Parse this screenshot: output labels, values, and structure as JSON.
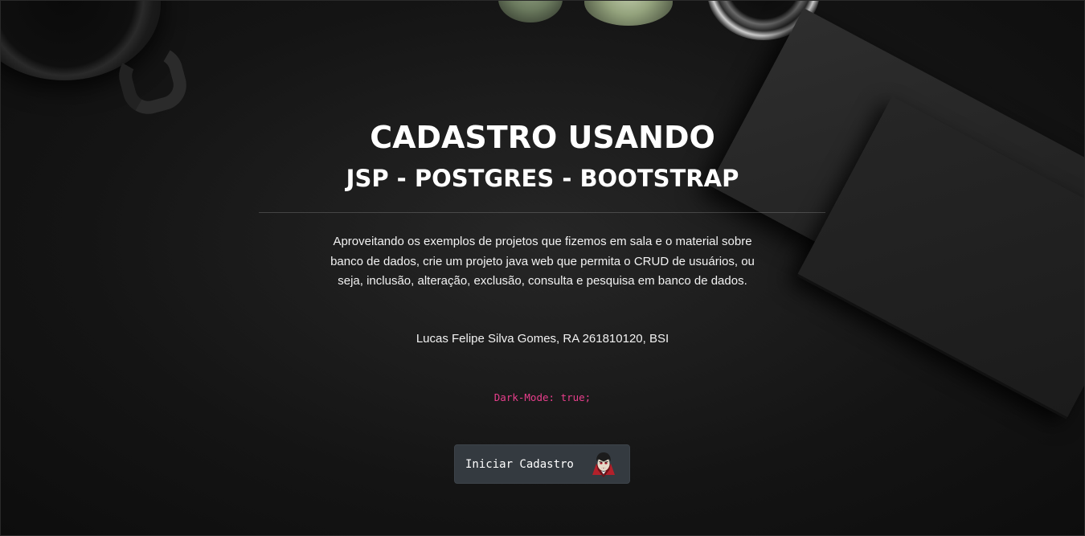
{
  "hero": {
    "title": "CADASTRO USANDO",
    "subtitle": "JSP - POSTGRES - BOOTSTRAP",
    "description": "Aproveitando os exemplos de projetos que fizemos em sala e o material sobre banco de dados, crie um projeto java web que permita o CRUD de usuários, ou seja, inclusão, alteração, exclusão, consulta e pesquisa em banco de dados.",
    "author": "Lucas Felipe Silva Gomes, RA 261810120, BSI",
    "dark_mode_code": "Dark-Mode: true;"
  },
  "start_button": {
    "label": "Iniciar Cadastro",
    "icon": "vampire-icon"
  },
  "colors": {
    "background": "#141414",
    "code_pink": "#e83e8c",
    "button_bg": "#343a40",
    "text": "#ffffff"
  }
}
